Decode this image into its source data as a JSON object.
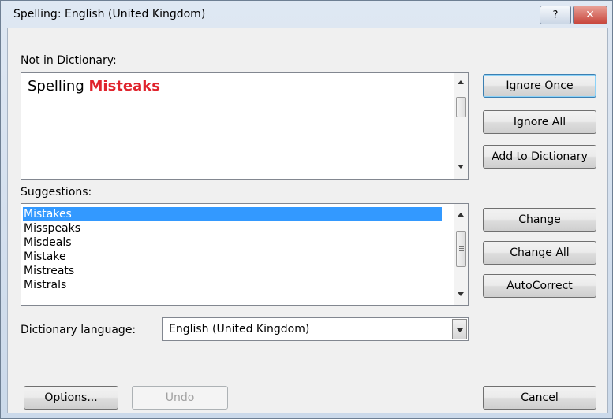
{
  "window": {
    "title": "Spelling: English (United Kingdom)"
  },
  "titlebar": {
    "help_glyph": "?",
    "close_glyph": "✕"
  },
  "not_in_dictionary": {
    "label": "Not in Dictionary:",
    "text_normal": "Spelling ",
    "text_error": "Misteaks"
  },
  "suggestions": {
    "label": "Suggestions:",
    "items": [
      "Mistakes",
      "Misspeaks",
      "Misdeals",
      "Mistake",
      "Mistreats",
      "Mistrals"
    ],
    "selected": "Mistakes"
  },
  "language": {
    "label": "Dictionary language:",
    "value": "English (United Kingdom)"
  },
  "buttons": {
    "ignore_once": "Ignore Once",
    "ignore_all": "Ignore All",
    "add_to_dictionary": "Add to Dictionary",
    "change": "Change",
    "change_all": "Change All",
    "autocorrect": "AutoCorrect",
    "options": "Options...",
    "undo": "Undo",
    "cancel": "Cancel"
  },
  "colors": {
    "error_text": "#e0242d",
    "selection": "#3399ff"
  }
}
